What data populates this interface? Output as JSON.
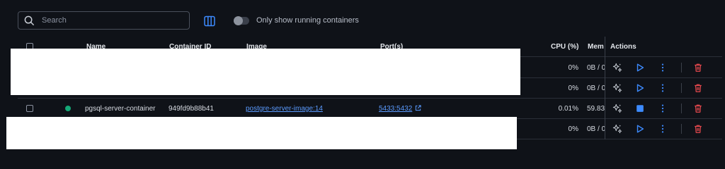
{
  "toolbar": {
    "search_placeholder": "Search",
    "toggle_label": "Only show running containers"
  },
  "table": {
    "headers": {
      "name": "Name",
      "container_id": "Container ID",
      "image": "Image",
      "ports": "Port(s)",
      "cpu": "CPU (%)",
      "memory": "Mem",
      "actions": "Actions"
    },
    "rows": [
      {
        "cpu": "0%",
        "memory": "0B / 0"
      },
      {
        "cpu": "0%",
        "memory": "0B / 0"
      },
      {
        "status_color": "#15a877",
        "name": "pgsql-server-container",
        "container_id": "949fd9b88b41",
        "image": "postgre-server-image:14",
        "ports": "5433:5432",
        "cpu": "0.01%",
        "memory": "59.83"
      },
      {
        "cpu": "0%",
        "memory": "0B / 0"
      }
    ]
  },
  "icons": {
    "search": "search-icon",
    "columns": "columns-icon",
    "ai": "sparkles-icon",
    "start": "play-icon",
    "stop": "stop-icon",
    "more": "more-vertical-icon",
    "delete": "trash-icon",
    "external": "external-link-icon"
  },
  "colors": {
    "accent": "#3d8bff",
    "link": "#5b9bff",
    "running": "#15a877",
    "delete": "#e5484d"
  }
}
